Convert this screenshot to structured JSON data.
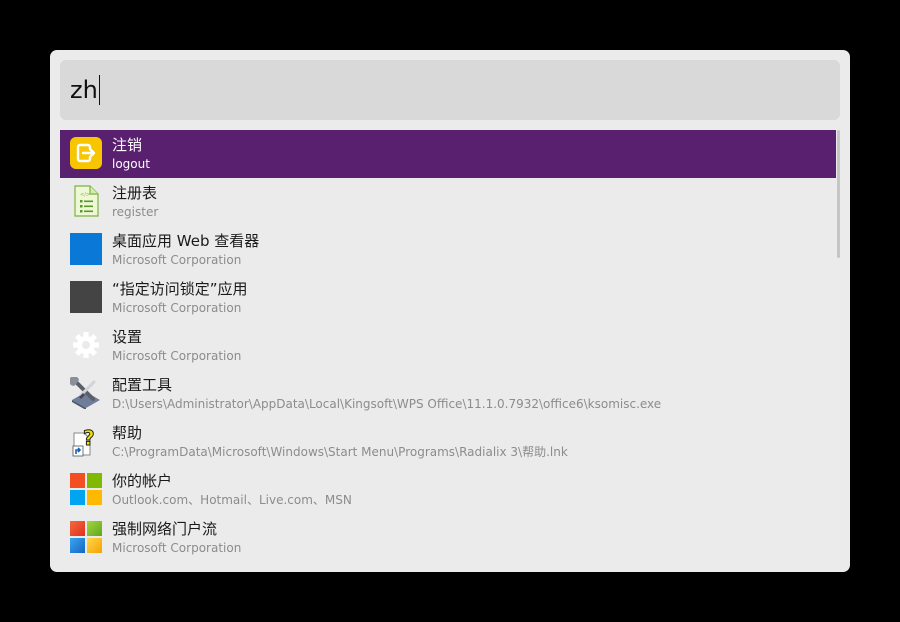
{
  "search": {
    "query": "zh"
  },
  "results": [
    {
      "title": "注销",
      "subtitle": "logout",
      "icon": "logout-icon",
      "selected": true
    },
    {
      "title": "注册表",
      "subtitle": "register",
      "icon": "registry-file-icon",
      "selected": false
    },
    {
      "title": "桌面应用 Web 查看器",
      "subtitle": "Microsoft Corporation",
      "icon": "app-tile-blue-icon",
      "selected": false
    },
    {
      "title": "“指定访问锁定”应用",
      "subtitle": "Microsoft Corporation",
      "icon": "app-tile-dark-icon",
      "selected": false
    },
    {
      "title": "设置",
      "subtitle": "Microsoft Corporation",
      "icon": "gear-icon",
      "selected": false
    },
    {
      "title": "配置工具",
      "subtitle": "D:\\Users\\Administrator\\AppData\\Local\\Kingsoft\\WPS Office\\11.1.0.7932\\office6\\ksomisc.exe",
      "icon": "tools-icon",
      "selected": false
    },
    {
      "title": "帮助",
      "subtitle": "C:\\ProgramData\\Microsoft\\Windows\\Start Menu\\Programs\\Radialix 3\\帮助.lnk",
      "icon": "help-shortcut-icon",
      "selected": false
    },
    {
      "title": "你的帐户",
      "subtitle": "Outlook.com、Hotmail、Live.com、MSN",
      "icon": "microsoft-logo-icon",
      "selected": false
    },
    {
      "title": "强制网络门户流",
      "subtitle": "Microsoft Corporation",
      "icon": "windows-logo-icon",
      "selected": false
    }
  ],
  "colors": {
    "selected_row": "#5a2070",
    "panel": "#ebebeb",
    "query_box": "#d9d9d9"
  }
}
